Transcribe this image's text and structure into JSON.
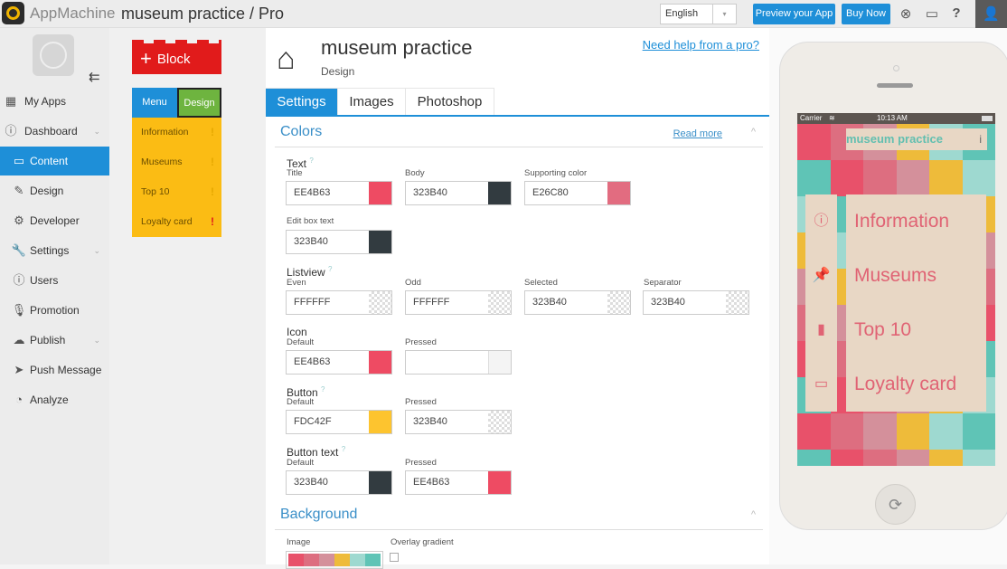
{
  "topbar": {
    "brand": "AppMachine",
    "app_title": "museum practice / Pro",
    "language": "English",
    "language_arrow": "▾",
    "preview_button": "Preview your App",
    "buy_button": "Buy Now",
    "support_icon": "⊗",
    "chat_icon": "▭",
    "help_icon": "?",
    "user_icon": "👤"
  },
  "sidebar": {
    "collapse_icon": "⇇",
    "items": [
      {
        "label": "My Apps",
        "icon": "▦"
      },
      {
        "label": "Dashboard",
        "icon": "ⓘ",
        "chevron": "⌄"
      },
      {
        "label": "Content",
        "icon": "▭"
      },
      {
        "label": "Design",
        "icon": "✎"
      },
      {
        "label": "Developer",
        "icon": "⚙"
      },
      {
        "label": "Settings",
        "icon": "🔧",
        "chevron": "⌄"
      },
      {
        "label": "Users",
        "icon": "ⓘ"
      },
      {
        "label": "Promotion",
        "icon": "🎙"
      },
      {
        "label": "Publish",
        "icon": "☁",
        "chevron": "⌄"
      },
      {
        "label": "Push Message",
        "icon": "➤"
      },
      {
        "label": "Analyze",
        "icon": "◔"
      }
    ]
  },
  "blocks": {
    "add_block": "Block",
    "add_icon": "+",
    "menu": "Menu",
    "design": "Design",
    "items": [
      {
        "label": "Information",
        "flag": "!"
      },
      {
        "label": "Museums",
        "flag": "!"
      },
      {
        "label": "Top 10",
        "flag": "!"
      },
      {
        "label": "Loyalty card",
        "flag": "!"
      }
    ]
  },
  "main": {
    "title": "museum practice",
    "subtitle": "Design",
    "help_link": "Need help from a pro?",
    "tabs": [
      "Settings",
      "Images",
      "Photoshop"
    ],
    "colors_section": {
      "title": "Colors",
      "read_more": "Read more",
      "collapse": "^"
    },
    "text_group": {
      "label": "Text",
      "help": "?",
      "fields": [
        {
          "label": "Title",
          "value": "EE4B63",
          "color": "#EE4B63"
        },
        {
          "label": "Body",
          "value": "323B40",
          "color": "#323B40"
        },
        {
          "label": "Supporting color",
          "value": "E26C80",
          "color": "#E26C80"
        },
        {
          "label": "Edit box text",
          "value": "323B40",
          "color": "#323B40"
        }
      ]
    },
    "listview_group": {
      "label": "Listview",
      "help": "?",
      "fields": [
        {
          "label": "Even",
          "value": "FFFFFF"
        },
        {
          "label": "Odd",
          "value": "FFFFFF"
        },
        {
          "label": "Selected",
          "value": "323B40"
        },
        {
          "label": "Separator",
          "value": "323B40"
        }
      ]
    },
    "icon_group": {
      "label": "Icon",
      "fields": [
        {
          "label": "Default",
          "value": "EE4B63",
          "color": "#EE4B63"
        },
        {
          "label": "Pressed",
          "value": "",
          "color": "#F4F4F4"
        }
      ]
    },
    "button_group": {
      "label": "Button",
      "help": "?",
      "fields": [
        {
          "label": "Default",
          "value": "FDC42F",
          "color": "#FDC42F"
        },
        {
          "label": "Pressed",
          "value": "323B40"
        }
      ]
    },
    "button_text_group": {
      "label": "Button text",
      "help": "?",
      "fields": [
        {
          "label": "Default",
          "value": "323B40",
          "color": "#323B40"
        },
        {
          "label": "Pressed",
          "value": "EE4B63",
          "color": "#EE4B63"
        }
      ]
    },
    "background_section": {
      "title": "Background",
      "collapse": "^",
      "image_label": "Image",
      "overlay_label": "Overlay gradient"
    }
  },
  "phone": {
    "carrier": "Carrier",
    "time": "10:13 AM",
    "app_header": "museum practice",
    "info_icon": "i",
    "items": [
      {
        "label": "Information",
        "icon": "ⓘ"
      },
      {
        "label": "Museums",
        "icon": "📌"
      },
      {
        "label": "Top 10",
        "icon": "▮"
      },
      {
        "label": "Loyalty card",
        "icon": "▭"
      }
    ],
    "home_icon": "⟳"
  },
  "palette": [
    "#E8516A",
    "#DD6E80",
    "#D4909B",
    "#EEBB3A",
    "#9ED9D0",
    "#5FC4B6"
  ]
}
